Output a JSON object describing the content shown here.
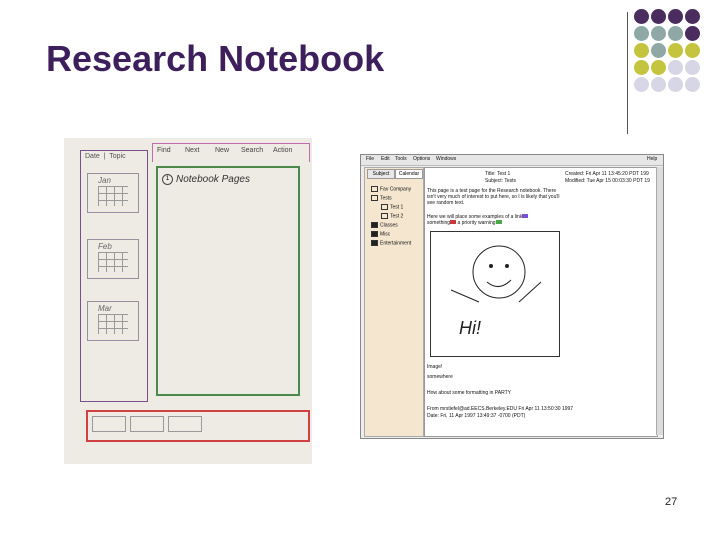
{
  "slide": {
    "title": "Research Notebook",
    "page_number": "27",
    "dot_colors": [
      "#4a2c5e",
      "#8fa8a6",
      "#c4c43e",
      "#d6d6e6"
    ]
  },
  "sketch": {
    "left_tabs": [
      "Date",
      "Topic"
    ],
    "months": [
      "Jan",
      "Feb",
      "Mar"
    ],
    "tabs": [
      "Find",
      "Next",
      "New",
      "Search",
      "Action"
    ],
    "page_number": "1",
    "page_title": "Notebook Pages"
  },
  "app": {
    "menu": [
      "File",
      "Edit",
      "Tools",
      "Options",
      "Windows"
    ],
    "help": "Help",
    "sidebar_tabs": [
      "Subject",
      "Calendar"
    ],
    "tree": [
      {
        "label": "Fav Company",
        "indent": 0,
        "icon": "folder-icon"
      },
      {
        "label": "Tests",
        "indent": 0,
        "icon": "folder-open-icon"
      },
      {
        "label": "Test 1",
        "indent": 1,
        "icon": "page-icon"
      },
      {
        "label": "Test 2",
        "indent": 1,
        "icon": "page-icon"
      },
      {
        "label": "Classes",
        "indent": 0,
        "icon": "folder-filled-icon"
      },
      {
        "label": "Misc",
        "indent": 0,
        "icon": "folder-filled-icon"
      },
      {
        "label": "Entertainment",
        "indent": 0,
        "icon": "folder-filled-icon"
      }
    ],
    "title_line": "Title: Test 1",
    "subject_line": "Subject: Tests",
    "created": "Created: Fri Apr 11 13:45:20 PDT 199",
    "modified": "Modified: Tue Apr 15 00:03:30 PDT 19",
    "para1": "This page is a test page for the Research notebook. There isn't very much of interest to put here, so I is likely that you'll see random text.",
    "para2": "Here we will place some examples of a link",
    "para2b": "something",
    "para2c": "a priority warning",
    "text_after": "Image!",
    "signature1": "somewhere",
    "line3": "How about some formatting in PARTY",
    "footer1": "From mrstiefel@ad.EECS.Berkeley.EDU Fri Apr 11 13:50:30 1997",
    "footer2": "Date: Fri, 11 Apr 1997 13:49:37 -0700 (PDT)",
    "drawing_text": "Hi!"
  }
}
